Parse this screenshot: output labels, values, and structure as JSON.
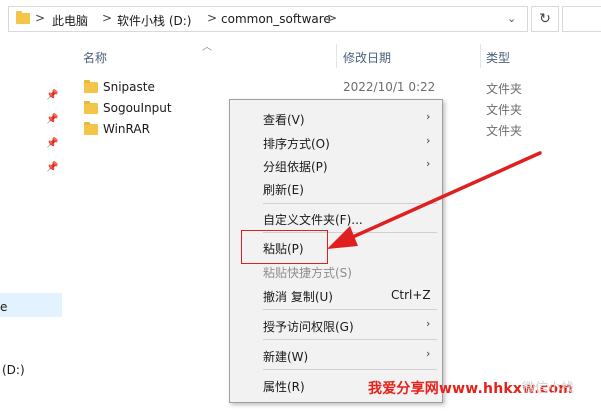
{
  "address": {
    "crumbs": [
      "此电脑",
      "软件小栈 (D:)",
      "common_software"
    ],
    "separator": ">",
    "dropdown_icon": "chevron-down-icon",
    "refresh_icon": "refresh-icon",
    "refresh_glyph": "↻"
  },
  "nav": {
    "items": [
      "e",
      "(D:)"
    ]
  },
  "columns": {
    "name": "名称",
    "date": "修改日期",
    "type": "类型"
  },
  "files": [
    {
      "name": "Snipaste",
      "date": "2022/10/1 0:22",
      "type": "文件夹"
    },
    {
      "name": "SogouInput",
      "date": "",
      "type": "文件夹"
    },
    {
      "name": "WinRAR",
      "date": "",
      "type": "文件夹"
    }
  ],
  "context_menu": {
    "items": [
      {
        "label": "查看(V)",
        "submenu": true
      },
      {
        "label": "排序方式(O)",
        "submenu": true
      },
      {
        "label": "分组依据(P)",
        "submenu": true
      },
      {
        "label": "刷新(E)"
      },
      {
        "label": "自定义文件夹(F)..."
      },
      {
        "label": "粘贴(P)"
      },
      {
        "label": "粘贴快捷方式(S)",
        "disabled": true
      },
      {
        "label": "撤消 复制(U)",
        "shortcut": "Ctrl+Z"
      },
      {
        "label": "授予访问权限(G)",
        "submenu": true
      },
      {
        "label": "新建(W)",
        "submenu": true
      },
      {
        "label": "属性(R)"
      }
    ],
    "chevron": "›"
  },
  "annotation": {
    "highlight_color": "#e02020"
  },
  "watermark": {
    "text": "我爱分享网www.hhkxw.com",
    "faint": "微信小栈"
  },
  "colors": {
    "folder": "#f3c64a",
    "menu_bg": "#f2f2f2",
    "accent_red": "#e8201a"
  }
}
